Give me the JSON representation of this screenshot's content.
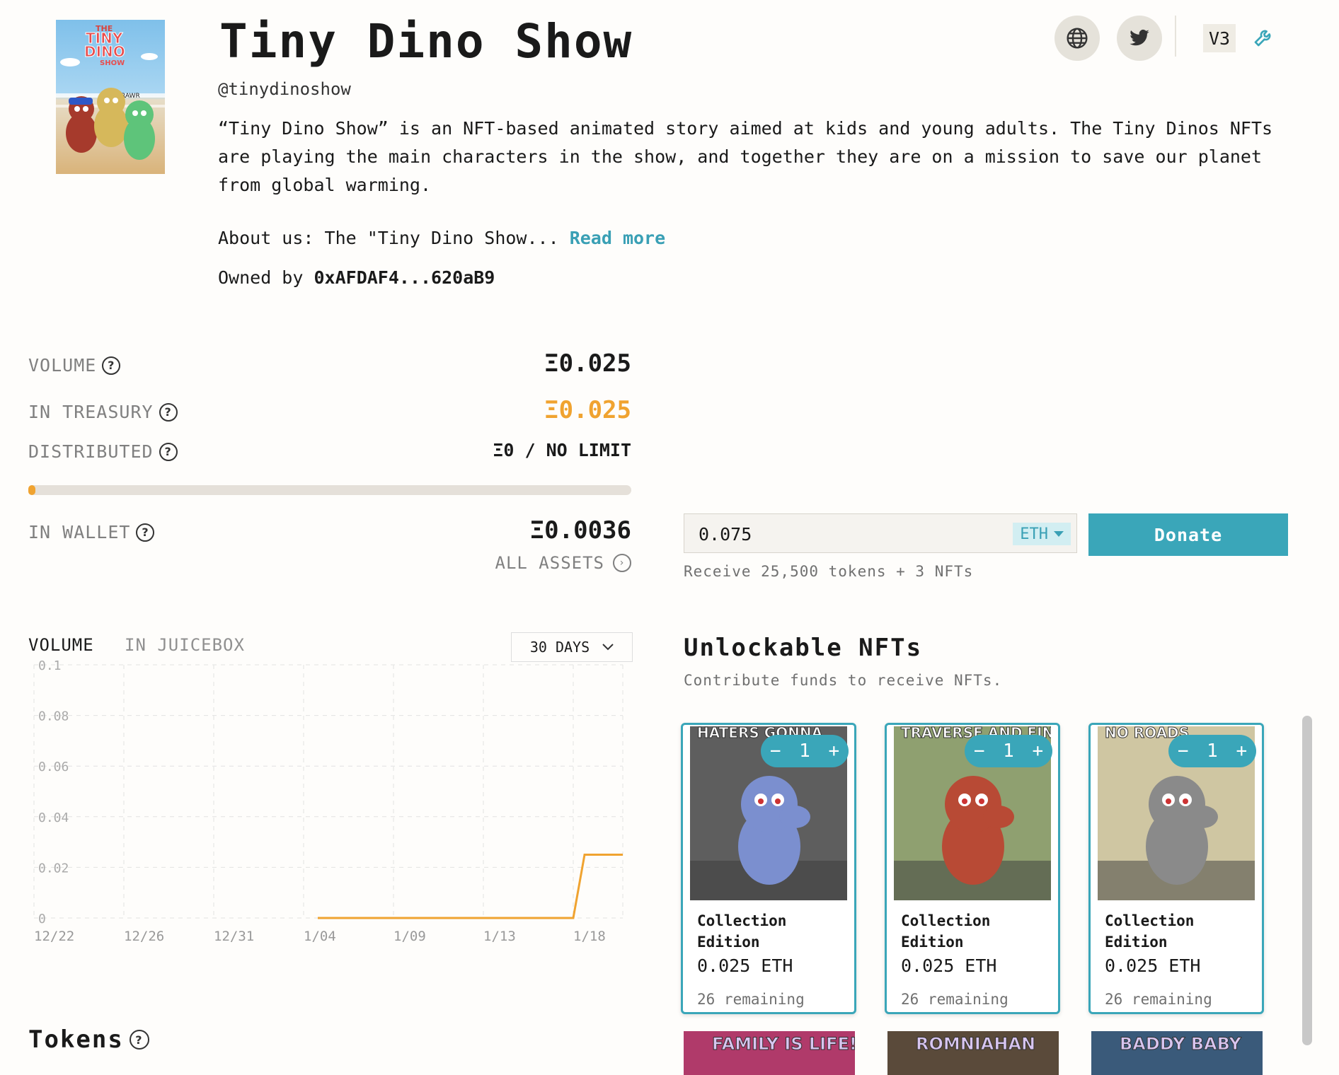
{
  "project": {
    "title": "Tiny Dino Show",
    "handle": "@tinydinoshow",
    "description": "“Tiny Dino Show” is an NFT-based animated story aimed at kids and young adults. The Tiny Dinos NFTs are playing the main characters in the show, and together they are on a mission to save our planet from global warming.",
    "about_text": "About us: The \"Tiny Dino Show...",
    "read_more": "Read more",
    "owned_by_label": "Owned by",
    "owner_address": "0xAFDAF4...620aB9",
    "version": "V3",
    "logo": {
      "line1": "THE",
      "line2": "TINY",
      "line3": "DINO",
      "line4": "SHOW",
      "speech": "RAWR"
    }
  },
  "icons": {
    "website": "globe-icon",
    "twitter": "twitter-icon",
    "settings": "wrench-icon"
  },
  "stats": {
    "volume_label": "VOLUME",
    "volume_value": "Ξ0.025",
    "treasury_label": "IN TREASURY",
    "treasury_value": "Ξ0.025",
    "distributed_label": "DISTRIBUTED",
    "distributed_value": "Ξ0 / NO LIMIT",
    "progress_fraction": 0.01,
    "wallet_label": "IN WALLET",
    "wallet_value": "Ξ0.0036",
    "all_assets": "ALL ASSETS"
  },
  "donate": {
    "amount": "0.075",
    "currency": "ETH",
    "button": "Donate",
    "receive_text": "Receive 25,500 tokens + 3 NFTs"
  },
  "chart_tabs": {
    "volume": "VOLUME",
    "in_juicebox": "IN JUICEBOX",
    "range": "30 DAYS"
  },
  "chart_data": {
    "type": "line",
    "x": [
      "1/04",
      "1/09",
      "1/13",
      "1/18",
      "1/19",
      "1/22"
    ],
    "values": [
      0,
      0,
      0,
      0,
      0.025,
      0.025
    ],
    "x_ticks": [
      "12/22",
      "12/26",
      "12/31",
      "1/04",
      "1/09",
      "1/13",
      "1/18"
    ],
    "y_ticks": [
      "0",
      "0.02",
      "0.04",
      "0.06",
      "0.08",
      "0.1"
    ],
    "ylim": [
      0,
      0.1
    ],
    "grid": true,
    "line_color": "#f0a330"
  },
  "nfts": {
    "heading": "Unlockable NFTs",
    "subheading": "Contribute funds to receive NFTs.",
    "items": [
      {
        "name": "Collection Edition",
        "price": "0.025 ETH",
        "remaining": "26 remaining",
        "qty": "1",
        "banner": "HATERS GONNA",
        "body_color": "#7b8fcf",
        "bg": "#5e5e5e"
      },
      {
        "name": "Collection Edition",
        "price": "0.025 ETH",
        "remaining": "26 remaining",
        "qty": "1",
        "banner": "TRAVERSE AND FIND",
        "body_color": "#b84a35",
        "bg": "#8fa070"
      },
      {
        "name": "Collection Edition",
        "price": "0.025 ETH",
        "remaining": "26 remaining",
        "qty": "1",
        "banner": "NO ROADS",
        "body_color": "#8a8a8a",
        "bg": "#cfc6a2"
      }
    ],
    "next_row": [
      {
        "banner": "FAMILY IS LIFE!!!",
        "bg": "#b03a6a"
      },
      {
        "banner": "ROMNIAHAN",
        "bg": "#5a4a3a"
      },
      {
        "banner": "BADDY BABY",
        "bg": "#3a5a7a"
      }
    ]
  },
  "tokens": {
    "heading": "Tokens"
  },
  "colors": {
    "accent": "#3aa6b9",
    "orange": "#f0a330"
  }
}
